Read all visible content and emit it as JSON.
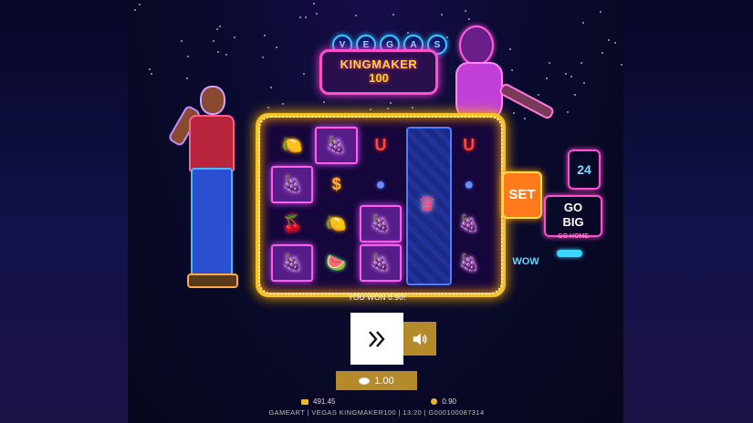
{
  "game": {
    "logo": {
      "vegas_letters": [
        "V",
        "E",
        "G",
        "A",
        "S"
      ],
      "title": "KINGMAKER",
      "number": "100"
    },
    "reels": [
      [
        "lemon",
        "grapes",
        "horseshoe",
        "",
        "horseshoe"
      ],
      [
        "grapes",
        "dollar",
        "plum",
        "",
        "plum"
      ],
      [
        "cherry",
        "lemon",
        "grapes",
        "",
        "grapes"
      ],
      [
        "grapes",
        "watermelon",
        "grapes",
        "",
        "grapes"
      ]
    ],
    "locked_reel_symbol": "crown",
    "win_cells": [
      [
        0,
        1
      ],
      [
        1,
        0
      ],
      [
        3,
        0
      ],
      [
        3,
        2
      ],
      [
        2,
        2
      ]
    ],
    "signs": {
      "sign_24": "24",
      "sign_set": "SET",
      "sign_go": "GO",
      "sign_big": "BIG",
      "sign_home": "GO HOME",
      "sign_wow": "WOW"
    }
  },
  "controls": {
    "win_message": "YOU WON 0.90!",
    "bet_value": "1.00",
    "spin_icon": "double-chevron-right-icon",
    "sound_icon": "speaker-icon"
  },
  "stats": {
    "balance": "491.45",
    "win": "0.90"
  },
  "footer": {
    "text": "GAMEART | VEGAS KINGMAKER100 | 13:20 | G000100087314"
  },
  "colors": {
    "frame_gold": "#f6c226",
    "neon_pink": "#ff4fd0",
    "button_gold": "#b48a2a",
    "background": "#0b0a2a"
  }
}
